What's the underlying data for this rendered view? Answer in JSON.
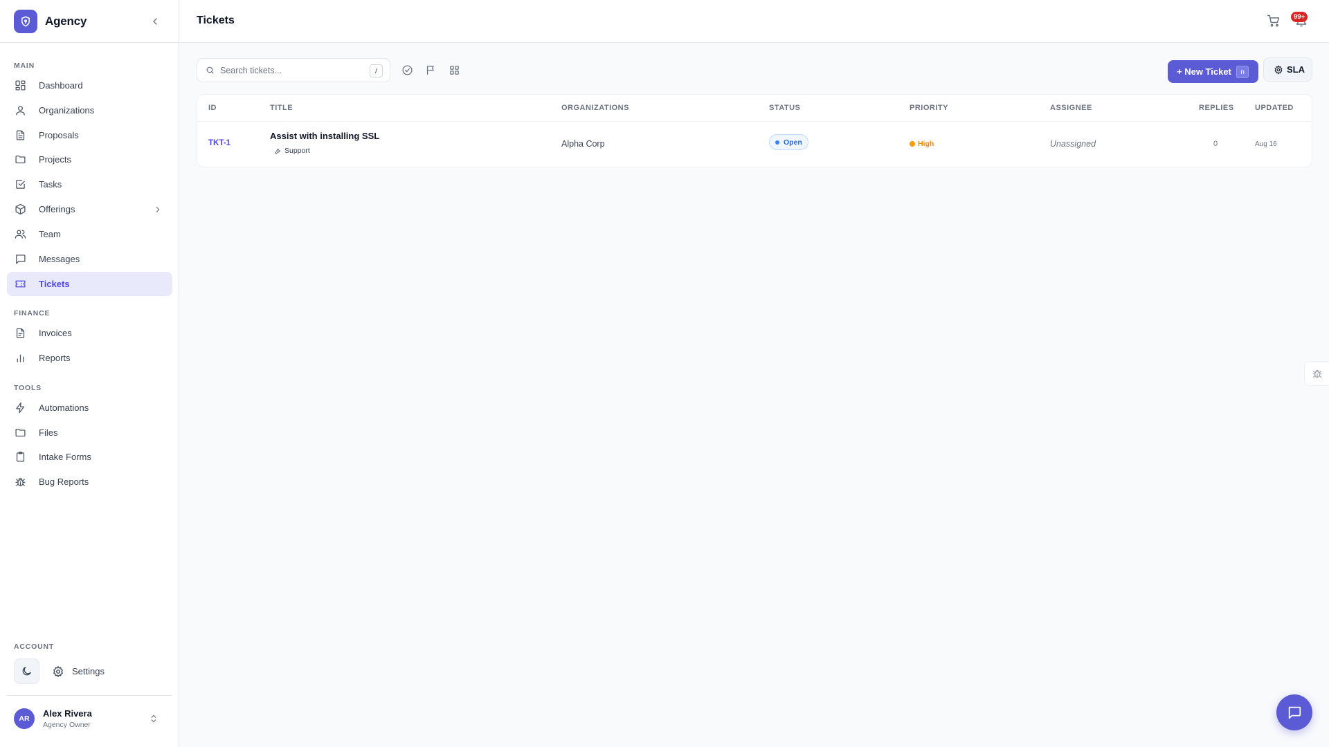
{
  "app": {
    "name": "Agency",
    "page_title": "Tickets"
  },
  "sidebar": {
    "sections": {
      "main": "MAIN",
      "finance": "FINANCE",
      "tools": "TOOLS",
      "account": "ACCOUNT"
    },
    "items": [
      {
        "label": "Dashboard",
        "icon": "dashboard-icon"
      },
      {
        "label": "Organizations",
        "icon": "user-icon"
      },
      {
        "label": "Proposals",
        "icon": "document-icon"
      },
      {
        "label": "Projects",
        "icon": "folder-icon"
      },
      {
        "label": "Tasks",
        "icon": "checkbox-icon"
      },
      {
        "label": "Offerings",
        "icon": "package-icon"
      },
      {
        "label": "Team",
        "icon": "users-icon"
      },
      {
        "label": "Messages",
        "icon": "message-icon"
      },
      {
        "label": "Tickets",
        "icon": "ticket-icon",
        "active": true
      },
      {
        "label": "Invoices",
        "icon": "invoice-icon"
      },
      {
        "label": "Reports",
        "icon": "bar-chart-icon"
      },
      {
        "label": "Automations",
        "icon": "bolt-icon"
      },
      {
        "label": "Files",
        "icon": "folder-icon"
      },
      {
        "label": "Intake Forms",
        "icon": "clipboard-icon"
      },
      {
        "label": "Bug Reports",
        "icon": "bug-icon"
      }
    ],
    "settings_label": "Settings",
    "user": {
      "initials": "AR",
      "name": "Alex Rivera",
      "role": "Agency Owner"
    }
  },
  "header": {
    "notification_badge": "99+"
  },
  "toolbar": {
    "search_placeholder": "Search tickets...",
    "search_shortcut": "/",
    "new_ticket_label": "+ New Ticket",
    "new_ticket_shortcut": "n",
    "sla_label": "SLA"
  },
  "table": {
    "columns": [
      "ID",
      "TITLE",
      "ORGANIZATIONS",
      "STATUS",
      "PRIORITY",
      "ASSIGNEE",
      "REPLIES",
      "UPDATED"
    ],
    "rows": [
      {
        "id": "TKT-1",
        "title": "Assist with installing SSL",
        "category": "Support",
        "organization": "Alpha Corp",
        "status": "Open",
        "priority": "High",
        "assignee": "Unassigned",
        "replies": "0",
        "updated": "Aug 16"
      }
    ]
  },
  "colors": {
    "accent": "#5b5bd6",
    "active_nav_bg": "#e8e9fb",
    "status_open": "#2563eb",
    "priority_high": "#f59e0b",
    "badge": "#dc2626"
  }
}
